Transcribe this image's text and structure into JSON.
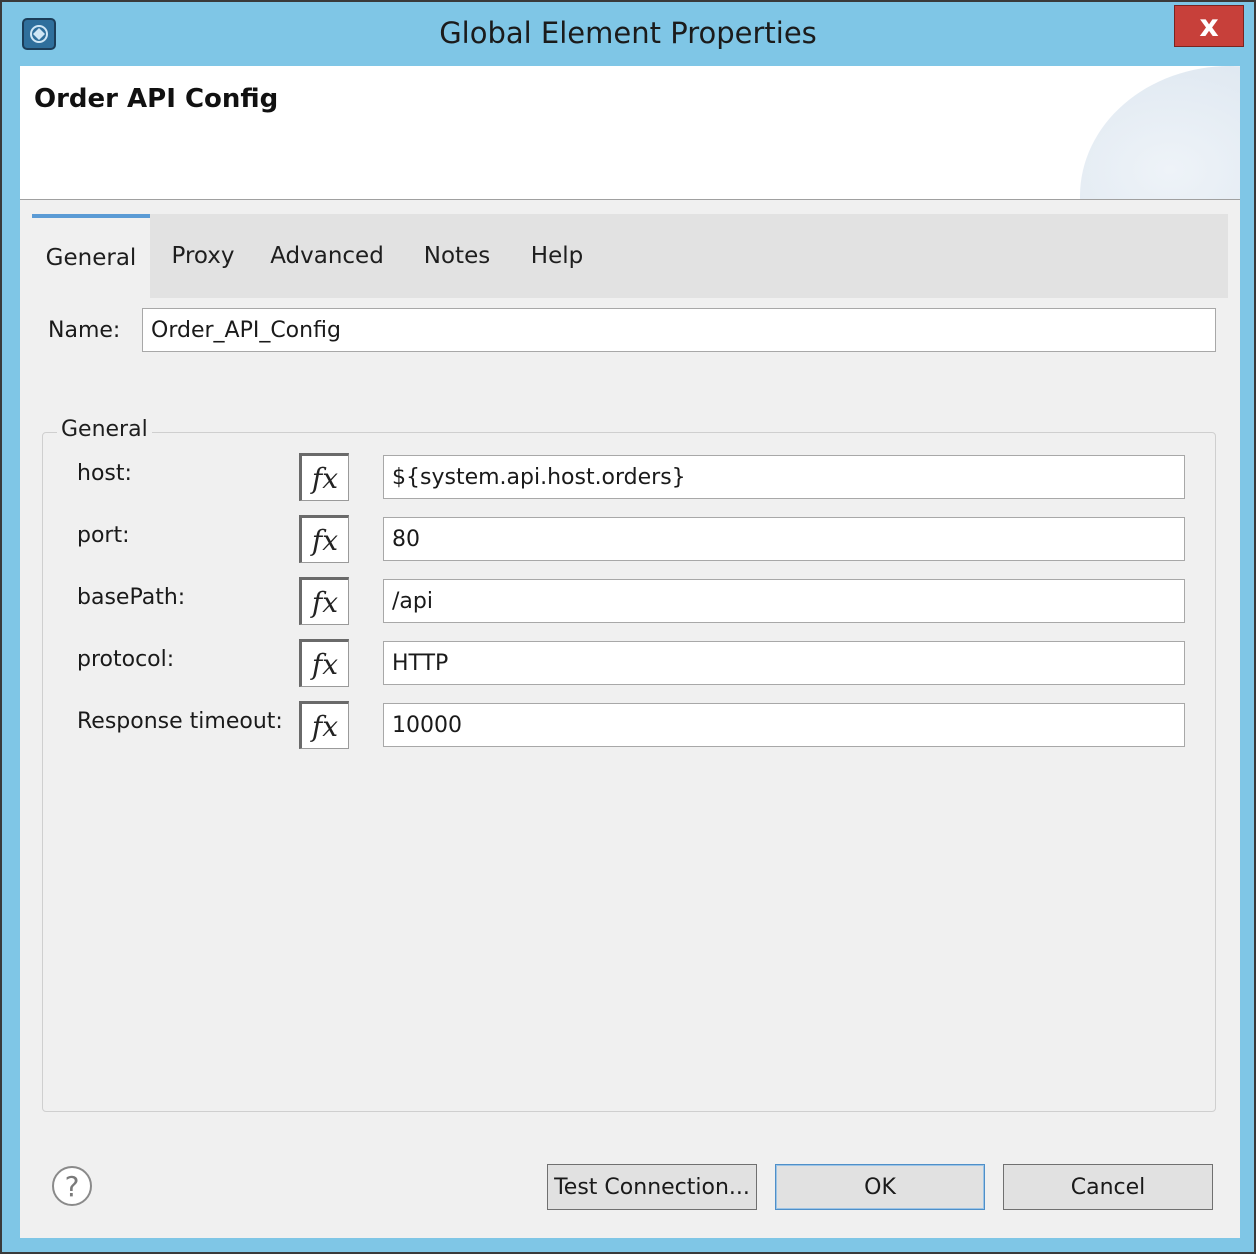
{
  "window": {
    "title": "Global Element Properties",
    "close_glyph": "x",
    "app_icon": "anypoint-studio-icon"
  },
  "header": {
    "title": "Order API Config"
  },
  "tabs": [
    {
      "label": "General",
      "active": true
    },
    {
      "label": "Proxy",
      "active": false
    },
    {
      "label": "Advanced",
      "active": false
    },
    {
      "label": "Notes",
      "active": false
    },
    {
      "label": "Help",
      "active": false
    }
  ],
  "name_field": {
    "label": "Name:",
    "value": "Order_API_Config"
  },
  "general_group": {
    "title": "General",
    "fx_label": "fx",
    "fields": [
      {
        "label": "host:",
        "value": "${system.api.host.orders}"
      },
      {
        "label": "port:",
        "value": "80"
      },
      {
        "label": "basePath:",
        "value": "/api"
      },
      {
        "label": "protocol:",
        "value": "HTTP"
      },
      {
        "label": "Response timeout:",
        "value": "10000"
      }
    ]
  },
  "footer": {
    "help_glyph": "?",
    "test_connection_label": "Test Connection...",
    "ok_label": "OK",
    "cancel_label": "Cancel"
  },
  "colors": {
    "window_frame": "#7fc6e6",
    "close_button": "#c7403a",
    "active_tab_accent": "#5b9bd5"
  }
}
